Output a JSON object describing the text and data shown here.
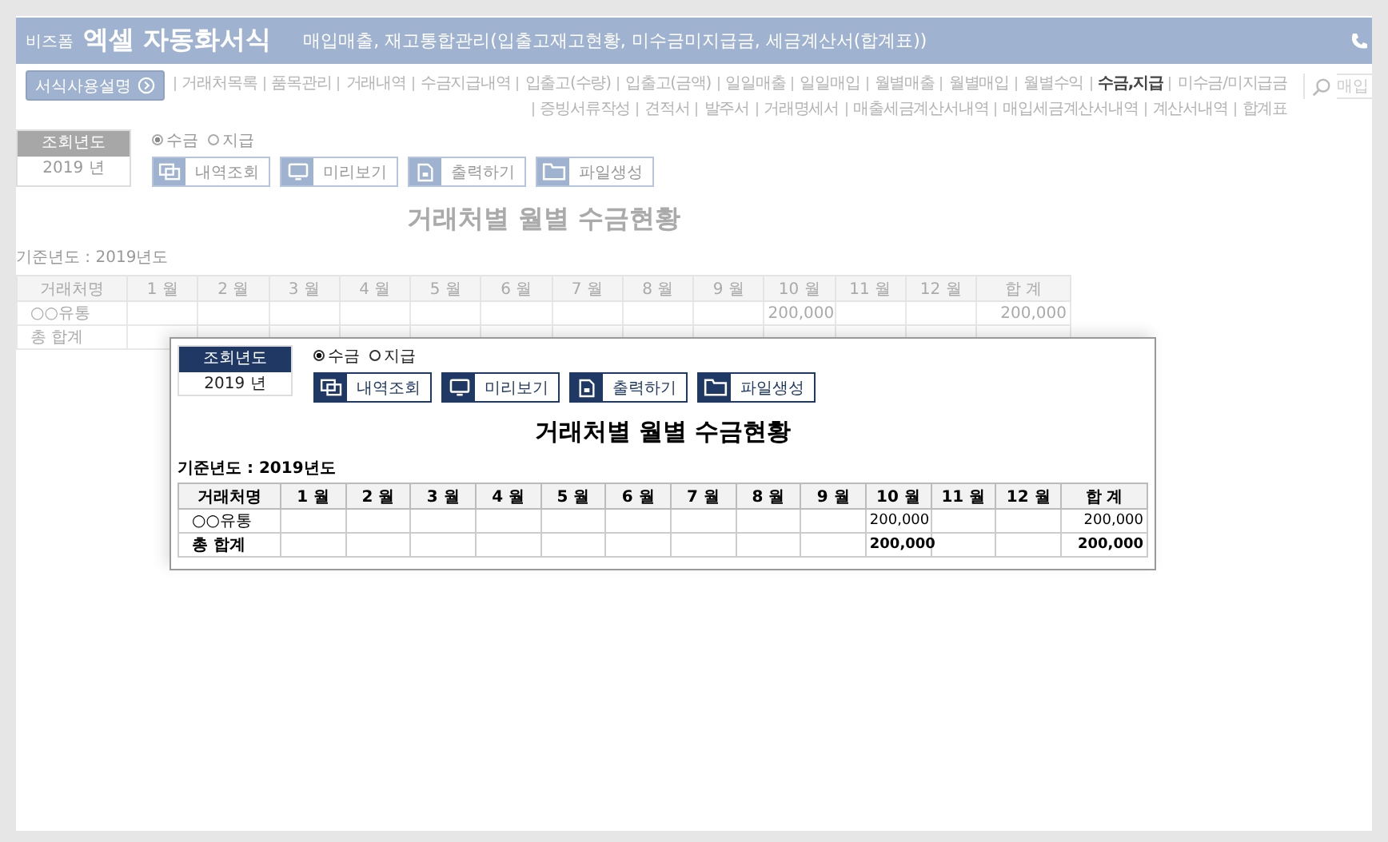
{
  "header": {
    "brand": "비즈폼",
    "title": "엑셀 자동화서식",
    "subtitle": "매입매출, 재고통합관리(입출고재고현황, 미수금미지급금, 세금계산서(합계표))"
  },
  "help_button": "서식사용설명",
  "nav": {
    "links": [
      {
        "label": "거래처목록",
        "selected": false
      },
      {
        "label": "품목관리",
        "selected": false
      },
      {
        "label": "거래내역",
        "selected": false
      },
      {
        "label": "수금지급내역",
        "selected": false
      },
      {
        "label": "입출고(수량)",
        "selected": false
      },
      {
        "label": "입출고(금액)",
        "selected": false
      },
      {
        "label": "일일매출",
        "selected": false
      },
      {
        "label": "일일매입",
        "selected": false
      },
      {
        "label": "월별매출",
        "selected": false
      },
      {
        "label": "월별매입",
        "selected": false
      },
      {
        "label": "월별수익",
        "selected": false
      },
      {
        "label": "수금,지급",
        "selected": true
      },
      {
        "label": "미수금/미지급금",
        "selected": false
      },
      {
        "label": "증빙서류작성",
        "selected": false
      },
      {
        "label": "견적서",
        "selected": false
      },
      {
        "label": "발주서",
        "selected": false
      },
      {
        "label": "거래명세서",
        "selected": false
      },
      {
        "label": "매출세금계산서내역",
        "selected": false
      },
      {
        "label": "매입세금계산서내역",
        "selected": false
      },
      {
        "label": "계산서내역",
        "selected": false
      },
      {
        "label": "합계표",
        "selected": false
      }
    ]
  },
  "search": {
    "placeholder": "매입"
  },
  "views": [
    {
      "kind": "faded",
      "year_label": "조회년도",
      "year": "2019 년",
      "radios": [
        {
          "label": "수금",
          "selected": true
        },
        {
          "label": "지급",
          "selected": false
        }
      ],
      "buttons": [
        {
          "label": "내역조회",
          "kind": "list"
        },
        {
          "label": "미리보기",
          "kind": "monitor"
        },
        {
          "label": "출력하기",
          "kind": "print"
        },
        {
          "label": "파일생성",
          "kind": "folder"
        }
      ],
      "title": "거래처별 월별 수금현황",
      "base_year": "기준년도 : 2019년도",
      "table": {
        "columns": [
          "거래처명",
          "1 월",
          "2 월",
          "3 월",
          "4 월",
          "5 월",
          "6 월",
          "7 월",
          "8 월",
          "9 월",
          "10 월",
          "11 월",
          "12 월",
          "합 계"
        ],
        "rows": [
          {
            "cells": [
              "○○유통",
              null,
              null,
              null,
              null,
              null,
              null,
              null,
              null,
              null,
              "200,000",
              null,
              null,
              "200,000"
            ]
          },
          {
            "cells": [
              "총 합계",
              null,
              null,
              null,
              null,
              null,
              null,
              null,
              null,
              null,
              null,
              null,
              null,
              null
            ]
          }
        ]
      }
    },
    {
      "kind": "zoomed",
      "year_label": "조회년도",
      "year": "2019 년",
      "radios": [
        {
          "label": "수금",
          "selected": true
        },
        {
          "label": "지급",
          "selected": false
        }
      ],
      "buttons": [
        {
          "label": "내역조회",
          "kind": "list"
        },
        {
          "label": "미리보기",
          "kind": "monitor"
        },
        {
          "label": "출력하기",
          "kind": "print"
        },
        {
          "label": "파일생성",
          "kind": "folder"
        }
      ],
      "title": "거래처별 월별 수금현황",
      "base_year": "기준년도 : 2019년도",
      "table": {
        "columns": [
          "거래처명",
          "1 월",
          "2 월",
          "3 월",
          "4 월",
          "5 월",
          "6 월",
          "7 월",
          "8 월",
          "9 월",
          "10 월",
          "11 월",
          "12 월",
          "합 계"
        ],
        "rows": [
          {
            "cells": [
              "○○유통",
              null,
              null,
              null,
              null,
              null,
              null,
              null,
              null,
              null,
              "200,000",
              null,
              null,
              "200,000"
            ]
          },
          {
            "cells": [
              "총 합계",
              null,
              null,
              null,
              null,
              null,
              null,
              null,
              null,
              null,
              "200,000",
              null,
              null,
              "200,000"
            ]
          }
        ]
      }
    }
  ]
}
